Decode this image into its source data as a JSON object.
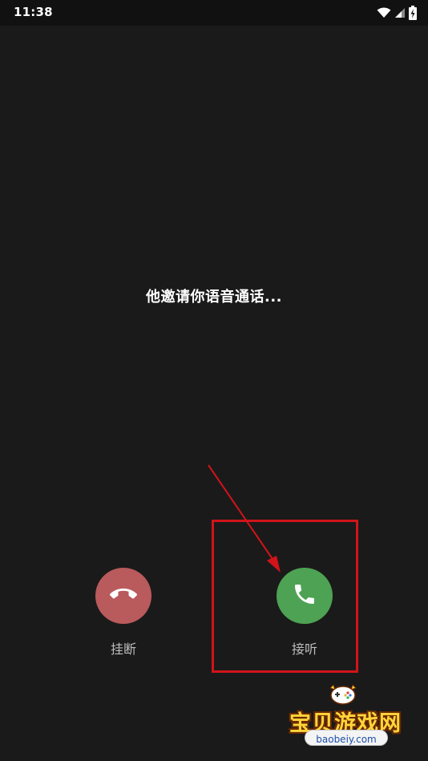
{
  "status_bar": {
    "time": "11:38",
    "icons": [
      "wifi-icon",
      "signal-icon",
      "battery-charging-icon"
    ]
  },
  "call": {
    "invite_text": "他邀请你语音通话...",
    "hangup_label": "挂断",
    "answer_label": "接听",
    "hangup_icon": "phone-hangup-icon",
    "answer_icon": "phone-answer-icon"
  },
  "colors": {
    "background": "#1a1a1a",
    "hangup": "#b95a5c",
    "answer": "#4ea253",
    "annotation": "#d0141a"
  },
  "watermark": {
    "title": "宝贝游戏网",
    "url": "baobeiy.com"
  }
}
